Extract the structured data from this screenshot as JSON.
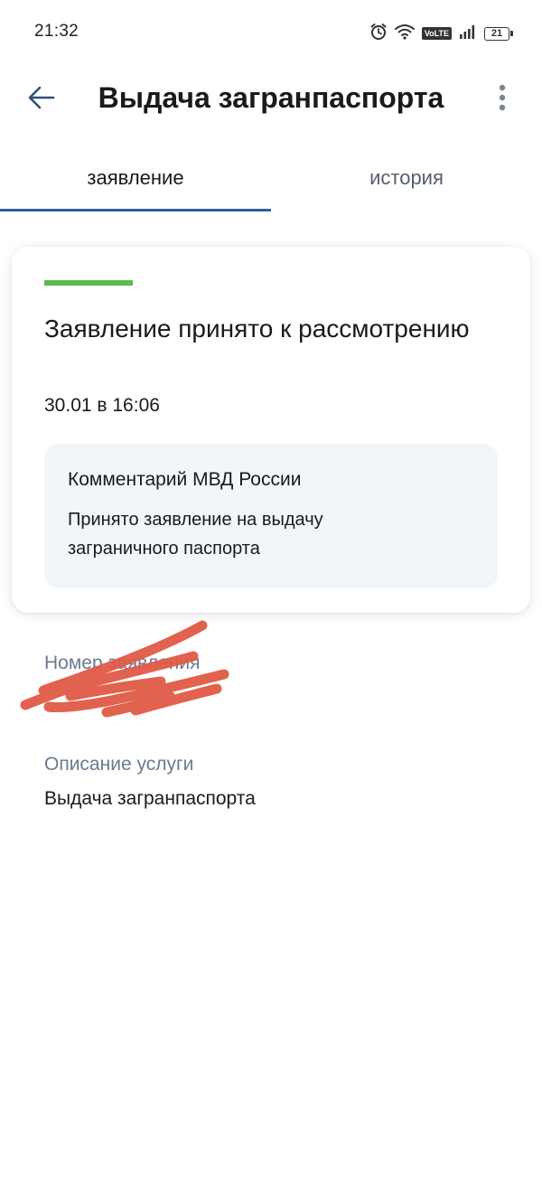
{
  "status_bar": {
    "time": "21:32",
    "volte_label": "VoLTE",
    "battery_level": "21"
  },
  "header": {
    "title": "Выдача загранпаспорта"
  },
  "tabs": [
    {
      "label": "заявление",
      "active": true
    },
    {
      "label": "история",
      "active": false
    }
  ],
  "status_card": {
    "status_color": "#5cba4f",
    "title": "Заявление принято к рассмотрению",
    "datetime": "30.01 в 16:06",
    "comment": {
      "title": "Комментарий МВД России",
      "text": "Принято заявление на выдачу заграничного паспорта"
    }
  },
  "fields": {
    "application_number": {
      "label": "Номер заявления",
      "value": ""
    },
    "service_description": {
      "label": "Описание услуги",
      "value": "Выдача загранпаспорта"
    }
  },
  "icons": {
    "back": "arrow-left-icon",
    "more": "more-vertical-icon",
    "alarm": "alarm-icon",
    "wifi": "wifi-icon",
    "signal": "signal-icon",
    "battery": "battery-icon"
  },
  "colors": {
    "accent": "#2b5da8",
    "status_ok": "#5cba4f",
    "label_gray": "#6b7a90",
    "comment_bg": "#f2f5fa",
    "redaction": "#e05a45"
  }
}
